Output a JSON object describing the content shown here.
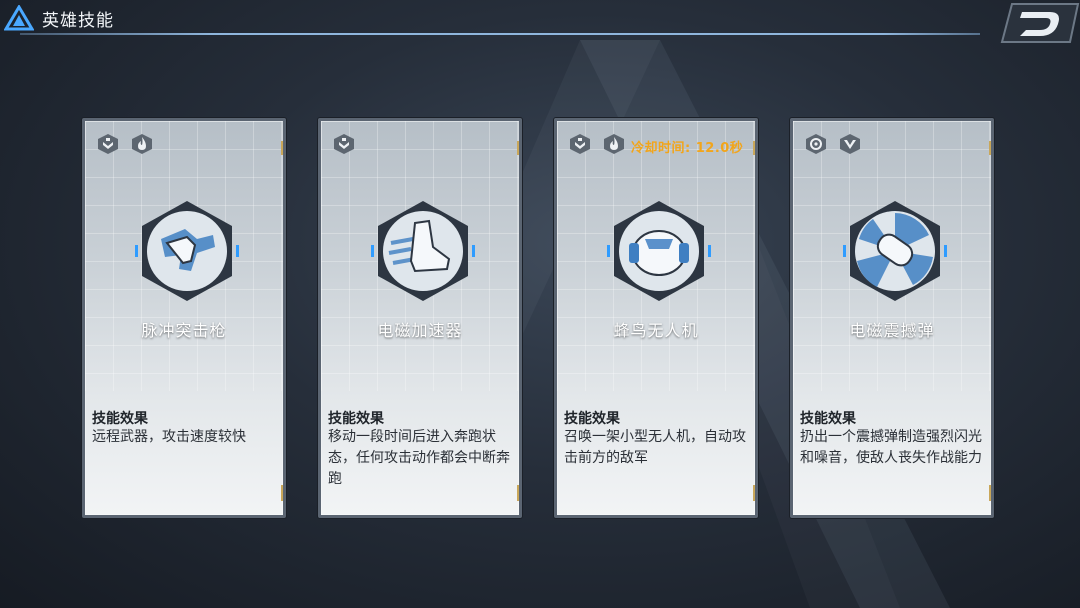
{
  "header": {
    "title": "英雄技能"
  },
  "labels": {
    "effect_title": "技能效果"
  },
  "accent_colors": {
    "cooldown": "#f2a51a",
    "header_line": "#8fb6dd",
    "card_trim": "#c9a75a"
  },
  "cards": [
    {
      "attr_icons": [
        "down-chevron-diamond-icon",
        "flame-icon"
      ],
      "cooldown": "",
      "name": "脉冲突击枪",
      "icon": "pulse-rifle-icon",
      "description": "远程武器，攻击速度较快"
    },
    {
      "attr_icons": [
        "down-chevron-diamond-icon"
      ],
      "cooldown": "",
      "name": "电磁加速器",
      "icon": "boot-accelerator-icon",
      "description": "移动一段时间后进入奔跑状态，任何攻击动作都会中断奔跑"
    },
    {
      "attr_icons": [
        "down-chevron-diamond-icon",
        "flame-icon"
      ],
      "cooldown": "冷却时间: 12.0秒",
      "name": "蜂鸟无人机",
      "icon": "drone-icon",
      "description": "召唤一架小型无人机，自动攻击前方的敌军"
    },
    {
      "attr_icons": [
        "target-ring-icon",
        "v-chevron-icon"
      ],
      "cooldown": "",
      "name": "电磁震撼弹",
      "icon": "shock-grenade-icon",
      "description": "扔出一个震撼弹制造强烈闪光和噪音，使敌人丧失作战能力"
    }
  ]
}
